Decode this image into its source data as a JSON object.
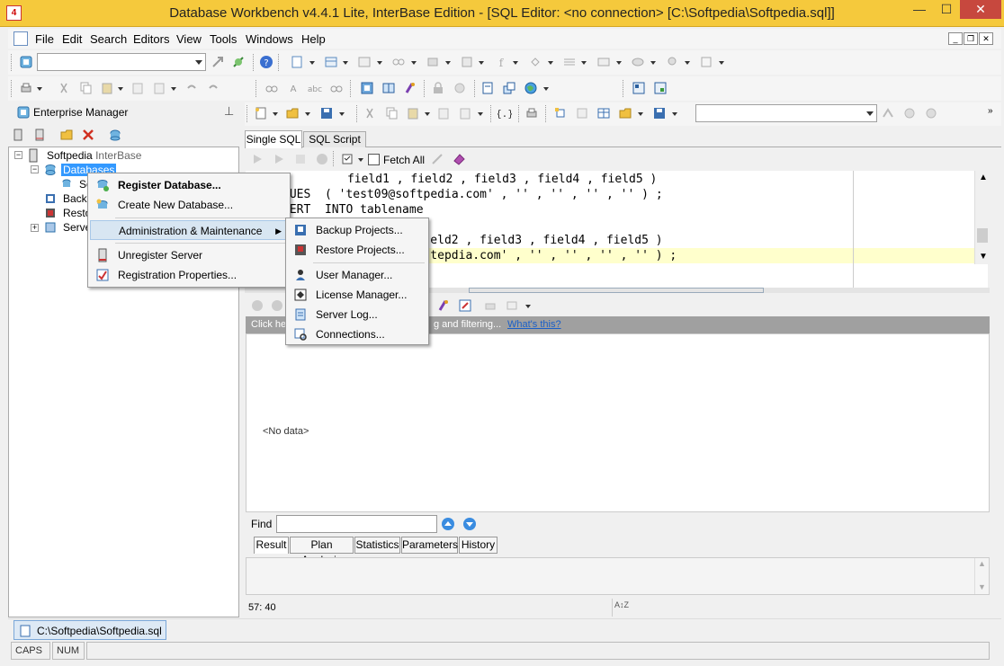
{
  "window": {
    "title": "Database Workbench v4.4.1 Lite, InterBase Edition - [SQL Editor: <no connection>  [C:\\Softpedia\\Softpedia.sql]]",
    "app_icon": "4",
    "minimize": "—",
    "maximize": "☐",
    "close": "✕"
  },
  "menu": {
    "items": [
      "File",
      "Edit",
      "Search",
      "Editors",
      "View",
      "Tools",
      "Windows",
      "Help"
    ],
    "mdi_min": "_",
    "mdi_restore": "❐",
    "mdi_close": "✕"
  },
  "enterprise_manager": {
    "title": "Enterprise Manager",
    "pin": "⊥",
    "tree": {
      "server_name": "Softpedia",
      "server_type": "InterBase",
      "databases": "Databases",
      "db_child": "So",
      "backup": "Backu",
      "restore": "Resto",
      "server": "Serve"
    }
  },
  "editor_tabs": [
    "Single SQL",
    "SQL Script"
  ],
  "editor_toolbar": {
    "fetch_all": "Fetch All"
  },
  "code_lines": [
    "      field1 , field2 , field3 , field4 , field5 )",
    "LUES  ( 'test09@softpedia.com' , '' , '' , '' , '' ) ;",
    "SERT  INTO tablename",
    "",
    "    eld2 , field3 , field4 , field5 )",
    "    tepdia.com' , '' , '' , '' , '' ) ;"
  ],
  "result_area": {
    "group_hint": "Click he",
    "group_hint_rest": "g and filtering...",
    "whats_this": "What's this?",
    "no_data": "<No data>"
  },
  "find": {
    "label": "Find",
    "value": ""
  },
  "result_tabs": [
    "Result",
    "Plan Analysis",
    "Statistics",
    "Parameters",
    "History"
  ],
  "editor_status": {
    "position": "57:  40"
  },
  "doc_tab": "C:\\Softpedia\\Softpedia.sql",
  "status": {
    "caps": "CAPS",
    "num": "NUM"
  },
  "context_menu": {
    "items": [
      "Register Database...",
      "Create New Database...",
      "Administration & Maintenance",
      "Unregister Server",
      "Registration Properties..."
    ]
  },
  "submenu": {
    "items": [
      "Backup Projects...",
      "Restore Projects...",
      "User Manager...",
      "License Manager...",
      "Server Log...",
      "Connections..."
    ]
  },
  "colors": {
    "titlebar": "#f5c93c",
    "close": "#c7483e",
    "selection": "#3399ff",
    "highlight_line": "#ffffcc",
    "link": "#0066cc"
  }
}
